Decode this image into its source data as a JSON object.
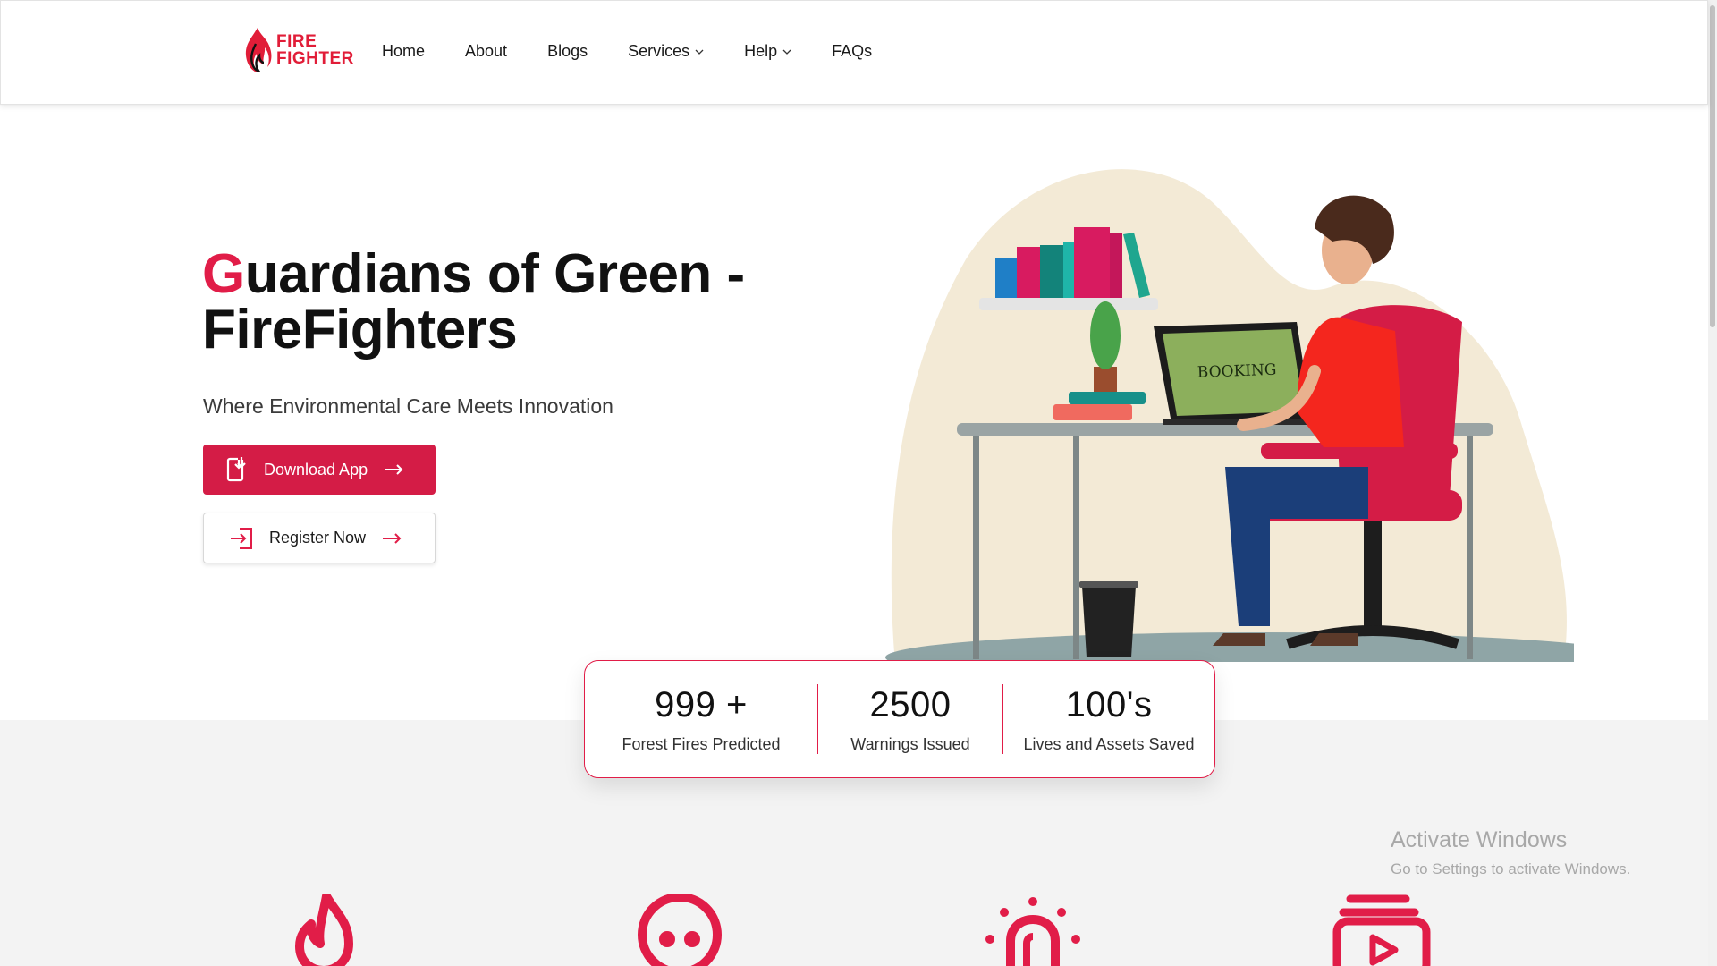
{
  "logo": {
    "line1": "FIRE",
    "line2": "FIGHTER",
    "icon": "flame-icon"
  },
  "nav": {
    "items": [
      {
        "label": "Home"
      },
      {
        "label": "About"
      },
      {
        "label": "Blogs"
      },
      {
        "label": "Services",
        "dropdown": true
      },
      {
        "label": "Help",
        "dropdown": true
      },
      {
        "label": "FAQs"
      }
    ]
  },
  "hero": {
    "title_first_letter": "G",
    "title_rest_line1": "uardians of Green -",
    "title_line2": "FireFighters",
    "subtitle": "Where Environmental Care Meets Innovation",
    "primary_button": {
      "label": "Download App",
      "icon": "download-phone-icon"
    },
    "secondary_button": {
      "label": "Register Now",
      "icon": "login-icon"
    },
    "illustration_screen_text": "BOOKING"
  },
  "stats": [
    {
      "value": "999 +",
      "label": "Forest Fires Predicted"
    },
    {
      "value": "2500",
      "label": "Warnings Issued"
    },
    {
      "value": "100's",
      "label": "Lives and Assets Saved"
    }
  ],
  "features": [
    {
      "icon": "flame-icon"
    },
    {
      "icon": "skull-icon"
    },
    {
      "icon": "alarm-siren-icon"
    },
    {
      "icon": "video-stack-icon"
    }
  ],
  "watermark": {
    "title": "Activate Windows",
    "subtitle": "Go to Settings to activate Windows."
  },
  "colors": {
    "accent": "#e11d48",
    "button": "#d41c46",
    "blob": "#f3ead6",
    "band": "#f3f3f3"
  }
}
